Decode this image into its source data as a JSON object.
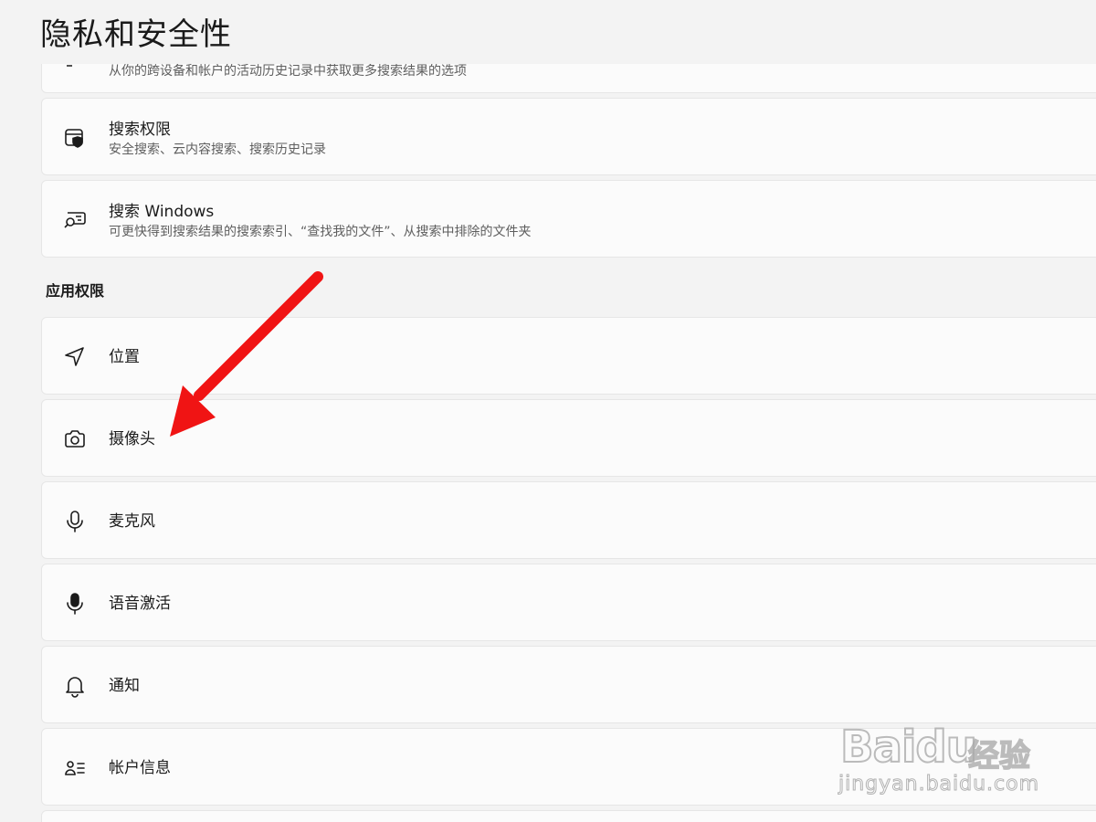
{
  "header": {
    "title": "隐私和安全性"
  },
  "cards_top": [
    {
      "label": "",
      "desc": "从你的跨设备和帐户的活动历史记录中获取更多搜索结果的选项",
      "icon": "history-icon"
    },
    {
      "label": "搜索权限",
      "desc": "安全搜索、云内容搜索、搜索历史记录",
      "icon": "search-shield-icon"
    },
    {
      "label": "搜索 Windows",
      "desc": "可更快得到搜索结果的搜索索引、“查找我的文件”、从搜索中排除的文件夹",
      "icon": "search-windows-icon"
    }
  ],
  "section": {
    "title": "应用权限"
  },
  "permissions": [
    {
      "label": "位置",
      "icon": "location-icon"
    },
    {
      "label": "摄像头",
      "icon": "camera-icon"
    },
    {
      "label": "麦克风",
      "icon": "microphone-icon"
    },
    {
      "label": "语音激活",
      "icon": "voice-activation-icon"
    },
    {
      "label": "通知",
      "icon": "bell-icon"
    },
    {
      "label": "帐户信息",
      "icon": "account-info-icon"
    }
  ],
  "annotation": {
    "color": "#f01414"
  },
  "watermark": {
    "brand": "Baidu",
    "cn": "经验",
    "url": "jingyan.baidu.com"
  }
}
